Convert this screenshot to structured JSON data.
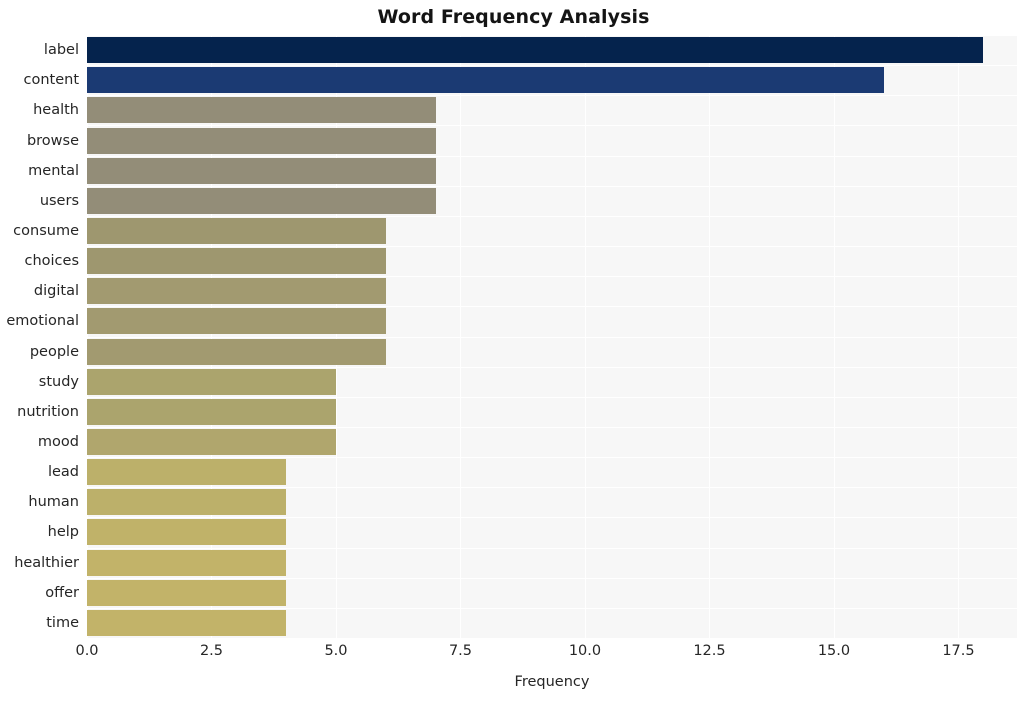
{
  "chart_data": {
    "type": "bar",
    "orientation": "horizontal",
    "title": "Word Frequency Analysis",
    "xlabel": "Frequency",
    "ylabel": "",
    "xlim": [
      0,
      18.675
    ],
    "xticks": [
      0.0,
      2.5,
      5.0,
      7.5,
      10.0,
      12.5,
      15.0,
      17.5
    ],
    "xtick_labels": [
      "0.0",
      "2.5",
      "5.0",
      "7.5",
      "10.0",
      "12.5",
      "15.0",
      "17.5"
    ],
    "grid": true,
    "grid_color": "#ffffff",
    "plot_background": "#f7f7f7",
    "figure_background": "#ffffff",
    "legend": null,
    "categories": [
      "label",
      "content",
      "health",
      "browse",
      "mental",
      "users",
      "consume",
      "choices",
      "digital",
      "emotional",
      "people",
      "study",
      "nutrition",
      "mood",
      "lead",
      "human",
      "help",
      "healthier",
      "offer",
      "time"
    ],
    "values": [
      18,
      16,
      7,
      7,
      7,
      7,
      6,
      6,
      6,
      6,
      6,
      5,
      5,
      5,
      4,
      4,
      4,
      4,
      4,
      4
    ],
    "bar_colors": [
      "#05234d",
      "#1b3a73",
      "#938d78",
      "#938d78",
      "#938d78",
      "#938d78",
      "#9e976f",
      "#9e976f",
      "#a29a70",
      "#a29a70",
      "#a29a70",
      "#aba46d",
      "#aba46d",
      "#b0a66d",
      "#bcb06a",
      "#bcb06a",
      "#c0b269",
      "#c2b369",
      "#c2b369",
      "#c2b369"
    ],
    "bars": [
      {
        "category": "label",
        "value": 18,
        "color": "#05234d"
      },
      {
        "category": "content",
        "value": 16,
        "color": "#1b3a73"
      },
      {
        "category": "health",
        "value": 7,
        "color": "#938d78"
      },
      {
        "category": "browse",
        "value": 7,
        "color": "#938d78"
      },
      {
        "category": "mental",
        "value": 7,
        "color": "#938d78"
      },
      {
        "category": "users",
        "value": 7,
        "color": "#938d78"
      },
      {
        "category": "consume",
        "value": 6,
        "color": "#9e976f"
      },
      {
        "category": "choices",
        "value": 6,
        "color": "#9e976f"
      },
      {
        "category": "digital",
        "value": 6,
        "color": "#a29a70"
      },
      {
        "category": "emotional",
        "value": 6,
        "color": "#a29a70"
      },
      {
        "category": "people",
        "value": 6,
        "color": "#a29a70"
      },
      {
        "category": "study",
        "value": 5,
        "color": "#aba46d"
      },
      {
        "category": "nutrition",
        "value": 5,
        "color": "#aba46d"
      },
      {
        "category": "mood",
        "value": 5,
        "color": "#b0a66d"
      },
      {
        "category": "lead",
        "value": 4,
        "color": "#bcb06a"
      },
      {
        "category": "human",
        "value": 4,
        "color": "#bcb06a"
      },
      {
        "category": "help",
        "value": 4,
        "color": "#c0b269"
      },
      {
        "category": "healthier",
        "value": 4,
        "color": "#c2b369"
      },
      {
        "category": "offer",
        "value": 4,
        "color": "#c2b369"
      },
      {
        "category": "time",
        "value": 4,
        "color": "#c2b369"
      }
    ]
  }
}
